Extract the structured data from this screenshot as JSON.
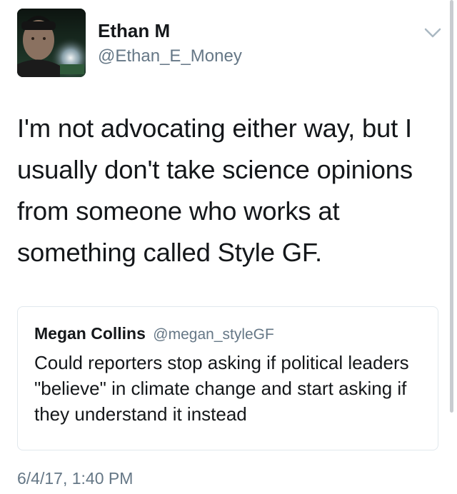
{
  "tweet": {
    "author": {
      "name": "Ethan M",
      "handle": "@Ethan_E_Money",
      "avatar_icon": "profile-photo"
    },
    "menu_icon": "chevron-down-icon",
    "text": "I'm not advocating either way, but I usually don't take science opinions from someone who works at something called Style GF.",
    "quoted_tweet": {
      "name": "Megan Collins",
      "handle": "@megan_styleGF",
      "text": "Could reporters stop asking if political leaders \"believe\" in climate change and start asking if they understand it instead"
    },
    "timestamp": "6/4/17, 1:40 PM"
  },
  "colors": {
    "text_primary": "#14171a",
    "text_secondary": "#657786",
    "border": "#e1e8ed"
  }
}
